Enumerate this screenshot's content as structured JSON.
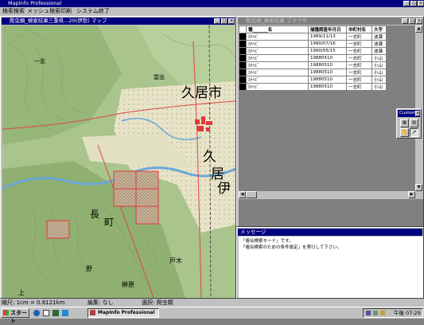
{
  "app": {
    "title": "MapInfo Professional"
  },
  "menu": [
    "検索検索",
    "メッシュ検索",
    "印刷",
    "システム終了"
  ],
  "map_window": {
    "title": "爬虫類_検索結果三重県...20(伊勢) マップ",
    "labels": [
      "久居市",
      "久",
      "居",
      "一志",
      "雲出",
      "伊",
      "長",
      "町",
      "野",
      "戸木",
      "榊原",
      "上"
    ]
  },
  "browser_window": {
    "title": "爬虫類_検索結果 ブラウザ",
    "columns": [
      "種_______名",
      "捕獲調査年月日",
      "市町村名",
      "大字"
    ],
    "rows": [
      [
        "ｶﾅﾍﾋﾞ",
        "1989/11/13",
        "一志町",
        "波瀬"
      ],
      [
        "ｶﾅﾍﾋﾞ",
        "1990/07/16",
        "一志町",
        "波瀬"
      ],
      [
        "ｶﾅﾍﾋﾞ",
        "1990/05/15",
        "一志町",
        "波瀬"
      ],
      [
        "ｶﾅﾍﾋﾞ",
        "19880510",
        "一志町",
        "小山"
      ],
      [
        "ｶﾅﾍﾋﾞ",
        "19880510",
        "一志町",
        "小山"
      ],
      [
        "ｶﾅﾍﾋﾞ",
        "19880510",
        "一志町",
        "小山"
      ],
      [
        "ｶﾅﾍﾋﾞ",
        "19880510",
        "一志町",
        "小山"
      ],
      [
        "ｶﾅﾍﾋﾞ",
        "19880510",
        "一志町",
        "小山"
      ]
    ]
  },
  "custom_toolbar": {
    "title": "Custom"
  },
  "message_window": {
    "title": "メッセージ",
    "lines": [
      "「複合検索モード」です。",
      "「複合検索のための条件設定」を実行して下さい。"
    ]
  },
  "status": {
    "scale": "縮尺: 1cm = 0.8121km",
    "edit": "編集: なし",
    "selection": "選択: 爬虫類"
  },
  "taskbar": {
    "start": "スタート",
    "task": "MapInfo Professional",
    "clock": "午後 07:29"
  },
  "colors": {
    "titlebar": "#000080",
    "face": "#c0c0c0",
    "highlight": "#e03a3a"
  }
}
